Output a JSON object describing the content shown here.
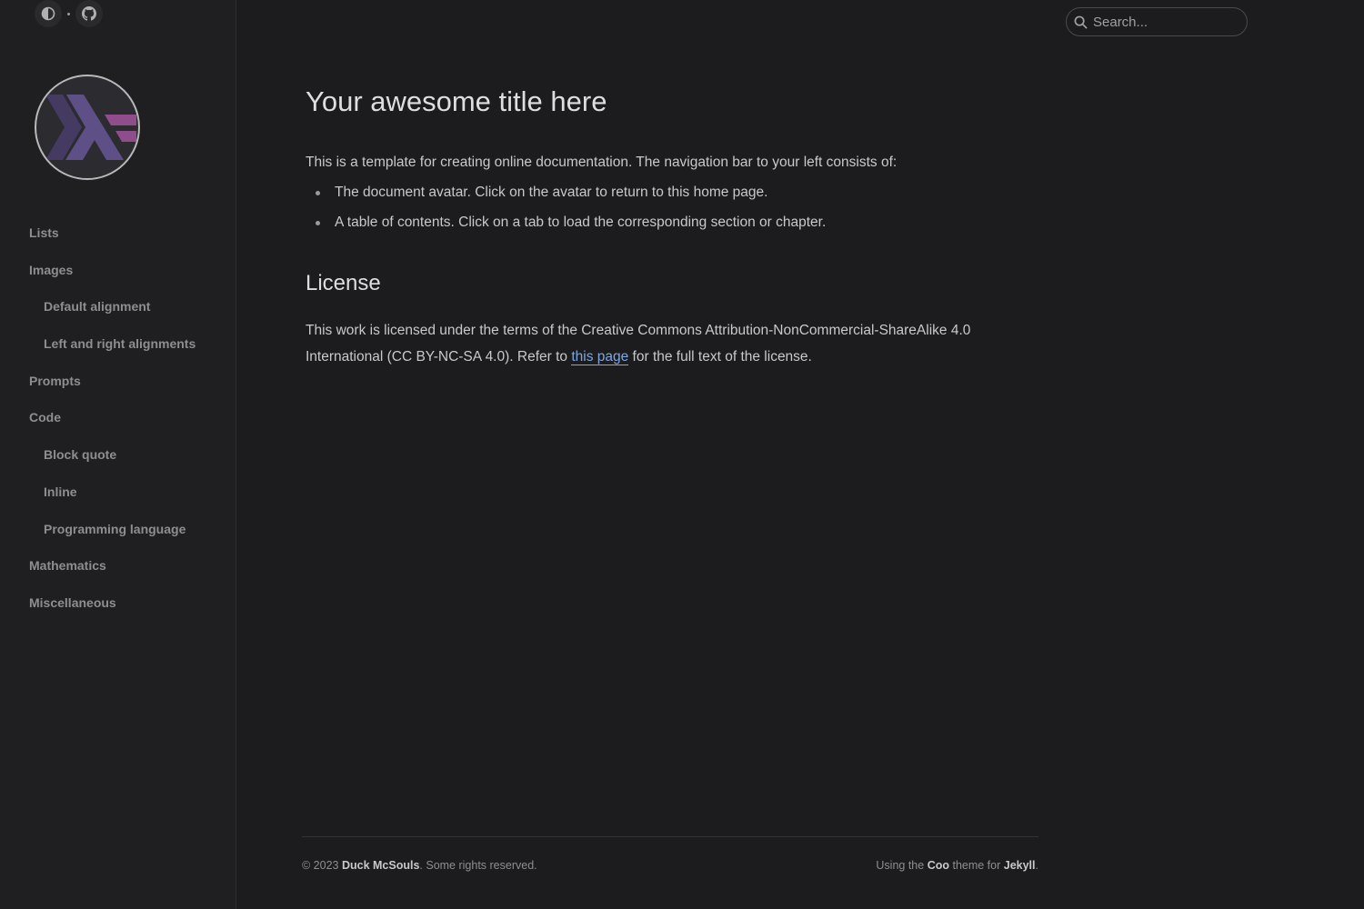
{
  "sidebar": {
    "items": [
      {
        "label": "Lists",
        "sub": false
      },
      {
        "label": "Images",
        "sub": false
      },
      {
        "label": "Default alignment",
        "sub": true
      },
      {
        "label": "Left and right alignments",
        "sub": true
      },
      {
        "label": "Prompts",
        "sub": false
      },
      {
        "label": "Code",
        "sub": false
      },
      {
        "label": "Block quote",
        "sub": true
      },
      {
        "label": "Inline",
        "sub": true
      },
      {
        "label": "Programming language",
        "sub": true
      },
      {
        "label": "Mathematics",
        "sub": false
      },
      {
        "label": "Miscellaneous",
        "sub": false
      }
    ],
    "icons": {
      "theme_toggle": "contrast-icon",
      "github": "github-icon",
      "avatar": "haskell-logo"
    }
  },
  "search": {
    "placeholder": "Search..."
  },
  "main": {
    "title": "Your awesome title here",
    "intro": "This is a template for creating online documentation. The navigation bar to your left consists of:",
    "bullets": [
      "The document avatar. Click on the avatar to return to this home page.",
      "A table of contents. Click on a tab to load the corresponding section or chapter."
    ],
    "license_title": "License",
    "license_text_before": "This work is licensed under the terms of the Creative Commons Attribution-NonCommercial-ShareAlike 4.0 International (CC BY-NC-SA 4.0). Refer to ",
    "license_link": "this page",
    "license_text_after": " for the full text of the license."
  },
  "footer": {
    "copyright_prefix": "© 2023 ",
    "author": "Duck McSouls",
    "copyright_suffix": ". Some rights reserved.",
    "using_prefix": "Using the ",
    "theme": "Coo",
    "theme_mid": " theme for ",
    "engine": "Jekyll",
    "using_suffix": "."
  },
  "colors": {
    "background": "#1c1c1e",
    "sidebar": "#1f1f21",
    "link": "#7fa6e0",
    "logo_dark": "#453a62",
    "logo_mid": "#5e5086",
    "logo_light": "#8f4e8b"
  }
}
